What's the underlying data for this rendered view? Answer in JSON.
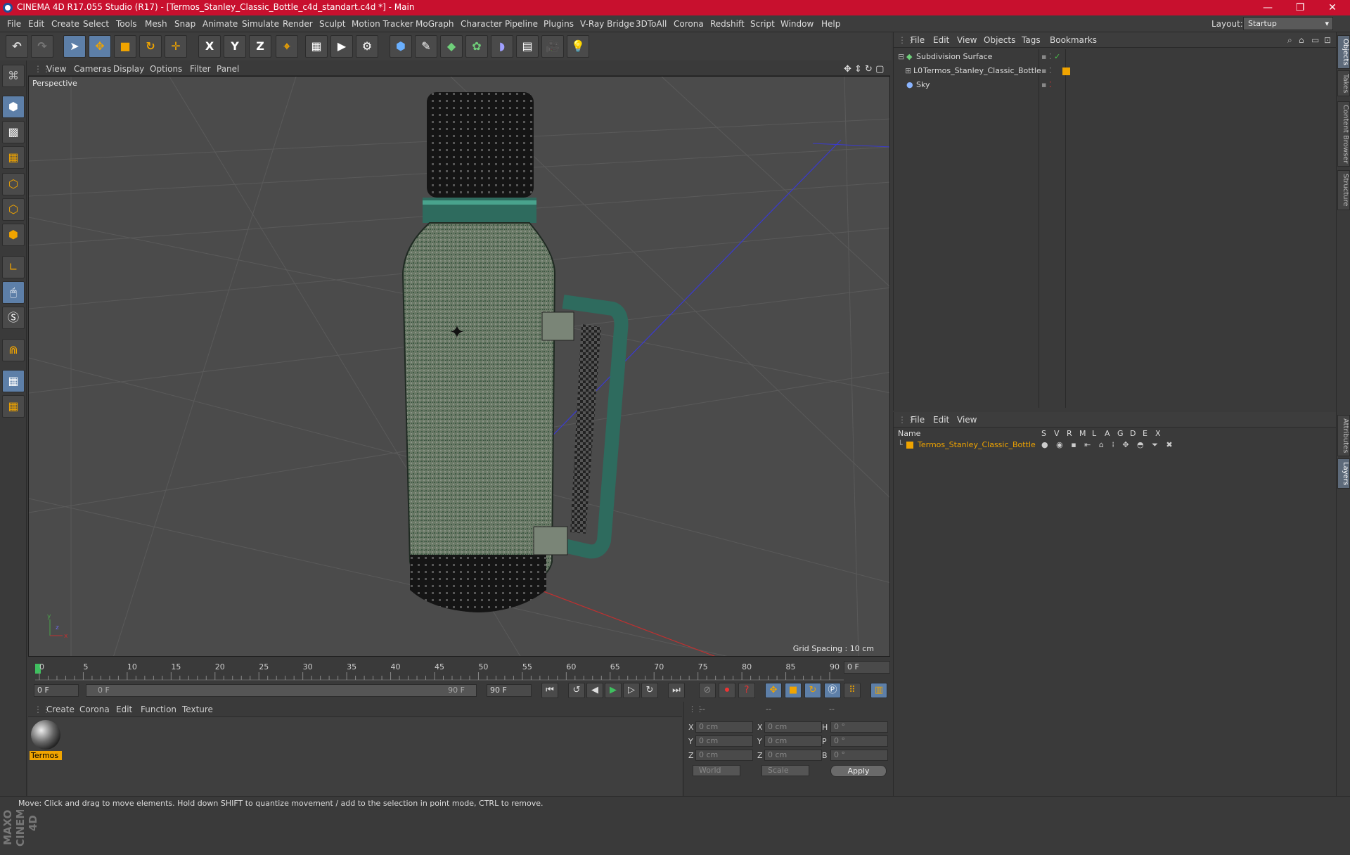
{
  "titlebar": {
    "title": "CINEMA 4D R17.055 Studio (R17) - [Termos_Stanley_Classic_Bottle_c4d_standart.c4d *] - Main",
    "minimize": "—",
    "restore": "❐",
    "close": "✕"
  },
  "menubar": {
    "items": [
      "File",
      "Edit",
      "Create",
      "Select",
      "Tools",
      "Mesh",
      "Snap",
      "Animate",
      "Simulate",
      "Render",
      "Sculpt",
      "Motion Tracker",
      "MoGraph",
      "Character",
      "Pipeline",
      "Plugins",
      "V-Ray Bridge",
      "3DToAll",
      "Corona",
      "Redshift",
      "Script",
      "Window",
      "Help"
    ],
    "layout_label": "Layout:",
    "layout_value": "Startup"
  },
  "toolbar": {
    "x_label": "X",
    "y_label": "Y",
    "z_label": "Z"
  },
  "viewport": {
    "menu": [
      "View",
      "Cameras",
      "Display",
      "Options",
      "Filter",
      "Panel"
    ],
    "label": "Perspective",
    "grid_spacing": "Grid Spacing : 10 cm"
  },
  "timeline": {
    "ticks": [
      "0",
      "5",
      "10",
      "15",
      "20",
      "25",
      "30",
      "35",
      "40",
      "45",
      "50",
      "55",
      "60",
      "65",
      "70",
      "75",
      "80",
      "85",
      "90"
    ],
    "current_frame": "0 F",
    "start_field": "0 F",
    "range_start": "0 F",
    "range_end": "90 F",
    "end_field": "90 F"
  },
  "materials": {
    "menu": [
      "Create",
      "Corona",
      "Edit",
      "Function",
      "Texture"
    ],
    "items": [
      {
        "name": "Termos"
      }
    ]
  },
  "coordinates": {
    "headers": [
      "--",
      "--",
      "--"
    ],
    "rows": [
      {
        "a": "X",
        "av": "0 cm",
        "b": "X",
        "bv": "0 cm",
        "c": "H",
        "cv": "0 °"
      },
      {
        "a": "Y",
        "av": "0 cm",
        "b": "Y",
        "bv": "0 cm",
        "c": "P",
        "cv": "0 °"
      },
      {
        "a": "Z",
        "av": "0 cm",
        "b": "Z",
        "bv": "0 cm",
        "c": "B",
        "cv": "0 °"
      }
    ],
    "world": "World",
    "scale": "Scale",
    "apply": "Apply"
  },
  "objects": {
    "menu": [
      "File",
      "Edit",
      "View",
      "Objects",
      "Tags",
      "Bookmarks"
    ],
    "items": [
      {
        "name": "Subdivision Surface",
        "color": "#dcdcdc"
      },
      {
        "name": "Termos_Stanley_Classic_Bottle",
        "color": "#dcdcdc"
      },
      {
        "name": "Sky",
        "color": "#dcdcdc"
      }
    ]
  },
  "layers": {
    "menu": [
      "File",
      "Edit",
      "View"
    ],
    "name_header": "Name",
    "columns": [
      "S",
      "V",
      "R",
      "M",
      "L",
      "A",
      "G",
      "D",
      "E",
      "X"
    ],
    "items": [
      {
        "name": "Termos_Stanley_Classic_Bottle",
        "color": "#f0a400"
      }
    ]
  },
  "right_tabs": [
    "Objects",
    "Takes",
    "Content Browser",
    "Structure",
    "Attributes",
    "Layers"
  ],
  "statusbar": {
    "text": "Move: Click and drag to move elements. Hold down SHIFT to quantize movement / add to the selection in point mode, CTRL to remove."
  },
  "branding": {
    "maxon": "MAXON CINEMA 4D"
  },
  "colors": {
    "accent": "#f0a400",
    "titlebar": "#c8102e",
    "selected_blue": "#5d7fa8"
  }
}
